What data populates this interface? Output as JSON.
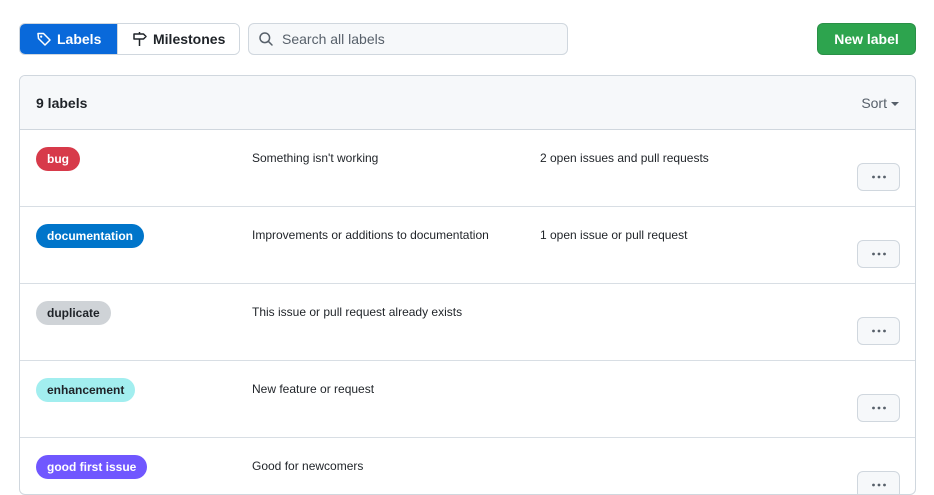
{
  "nav": {
    "labels_tab": "Labels",
    "milestones_tab": "Milestones"
  },
  "search": {
    "placeholder": "Search all labels",
    "value": ""
  },
  "actions": {
    "new_label": "New label"
  },
  "list": {
    "count_label": "9 labels",
    "sort_label": "Sort",
    "rows": [
      {
        "name": "bug",
        "color": "#d73a4a",
        "text_color": "#ffffff",
        "description": "Something isn't working",
        "issues": "2 open issues and pull requests"
      },
      {
        "name": "documentation",
        "color": "#0075ca",
        "text_color": "#ffffff",
        "description": "Improvements or additions to documentation",
        "issues": "1 open issue or pull request"
      },
      {
        "name": "duplicate",
        "color": "#cfd3d7",
        "text_color": "#1f2328",
        "description": "This issue or pull request already exists",
        "issues": ""
      },
      {
        "name": "enhancement",
        "color": "#a2eeef",
        "text_color": "#1f2328",
        "description": "New feature or request",
        "issues": ""
      },
      {
        "name": "good first issue",
        "color": "#7057ff",
        "text_color": "#ffffff",
        "description": "Good for newcomers",
        "issues": ""
      }
    ]
  },
  "icons": {
    "labels_tab": "tag-icon",
    "milestones_tab": "milestone-icon",
    "search": "search-icon",
    "row_menu": "kebab-horizontal-icon",
    "sort": "triangle-down-icon"
  },
  "colors": {
    "accent": "#0969da",
    "primary_button": "#2da44e"
  }
}
